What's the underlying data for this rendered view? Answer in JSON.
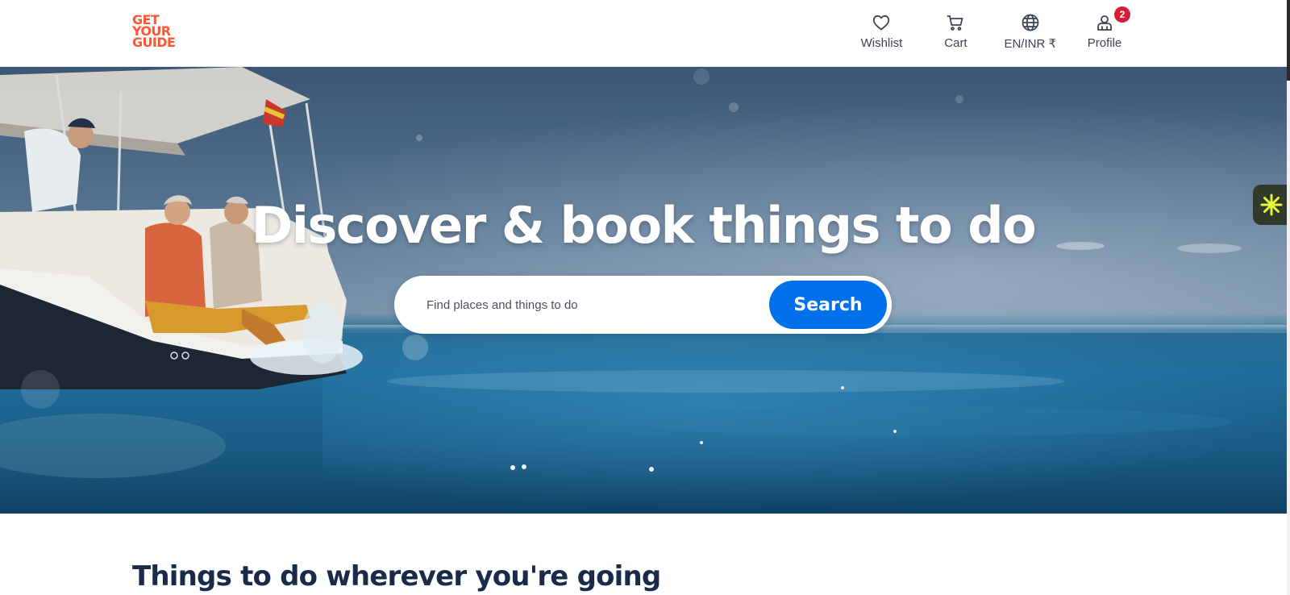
{
  "logo": {
    "lines": [
      "GET",
      "YOUR",
      "GUIDE"
    ],
    "color": "#ff5533"
  },
  "nav": {
    "wishlist": {
      "label": "Wishlist",
      "icon": "heart-icon"
    },
    "cart": {
      "label": "Cart",
      "icon": "cart-icon"
    },
    "language": {
      "label": "EN/INR ₹",
      "icon": "globe-icon"
    },
    "profile": {
      "label": "Profile",
      "icon": "profile-icon",
      "badge": "2"
    }
  },
  "hero": {
    "title": "Discover & book things to do",
    "search": {
      "placeholder": "Find places and things to do",
      "value": "",
      "button_label": "Search"
    }
  },
  "side_widget": {
    "icon": "asterisk-icon"
  },
  "section": {
    "title": "Things to do wherever you're going"
  },
  "colors": {
    "accent": "#0071eb",
    "brand": "#ff5533",
    "badge": "#d61d3a",
    "heading": "#1a2b49"
  }
}
